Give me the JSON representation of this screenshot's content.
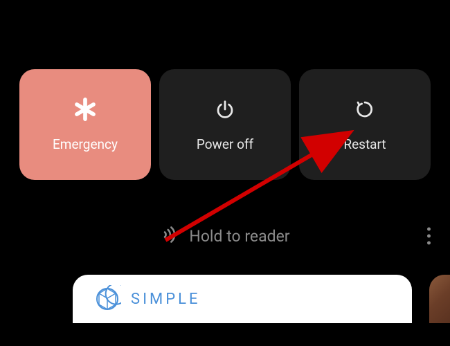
{
  "power_menu": {
    "emergency": {
      "label": "Emergency"
    },
    "power_off": {
      "label": "Power off"
    },
    "restart": {
      "label": "Restart"
    }
  },
  "nfc": {
    "text": "Hold to reader"
  },
  "card": {
    "brand": "SIMPLE"
  }
}
